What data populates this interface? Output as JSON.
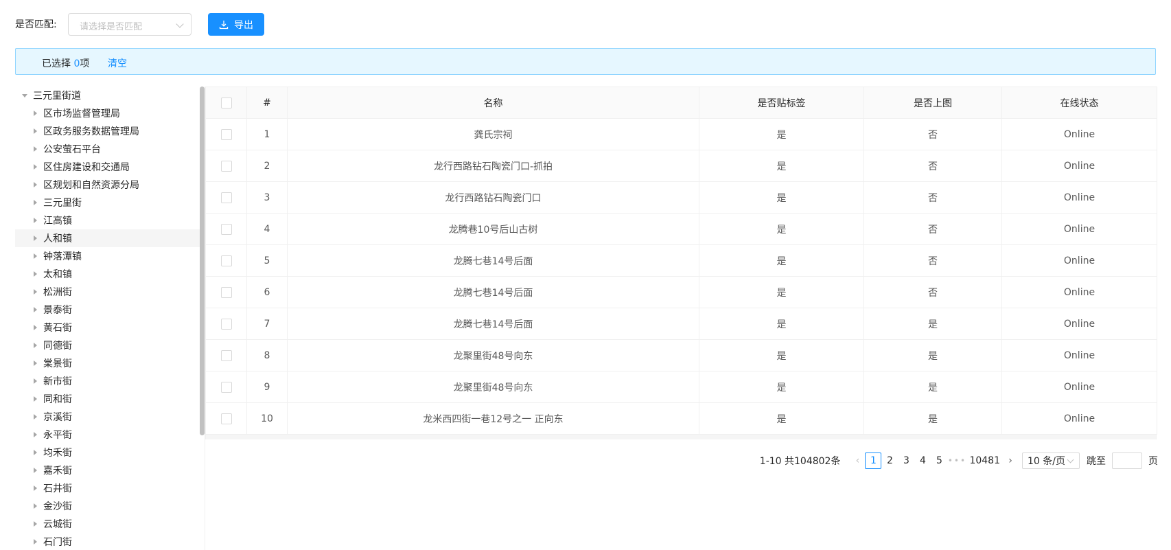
{
  "filter": {
    "label": "是否匹配:",
    "placeholder": "请选择是否匹配",
    "export_label": "导出"
  },
  "alert": {
    "selected_prefix": "已选择",
    "selected_count": "0",
    "selected_suffix": "项",
    "clear_label": "清空"
  },
  "tree": {
    "root": "三元里街道",
    "children": [
      "区市场监督管理局",
      "区政务服务数据管理局",
      "公安萤石平台",
      "区住房建设和交通局",
      "区规划和自然资源分局",
      "三元里街",
      "江高镇",
      "人和镇",
      "钟落潭镇",
      "太和镇",
      "松洲街",
      "景泰街",
      "黄石街",
      "同德街",
      "棠景街",
      "新市街",
      "同和街",
      "京溪街",
      "永平街",
      "均禾街",
      "嘉禾街",
      "石井街",
      "金沙街",
      "云城街",
      "石门街"
    ],
    "active_index": 7
  },
  "table": {
    "columns": [
      "#",
      "名称",
      "是否贴标签",
      "是否上图",
      "在线状态"
    ],
    "rows": [
      {
        "index": "1",
        "name": "龚氏宗祠",
        "labeled": "是",
        "mapped": "否",
        "status": "Online"
      },
      {
        "index": "2",
        "name": "龙行西路钻石陶瓷门口-抓拍",
        "labeled": "是",
        "mapped": "否",
        "status": "Online"
      },
      {
        "index": "3",
        "name": "龙行西路钻石陶瓷门口",
        "labeled": "是",
        "mapped": "否",
        "status": "Online"
      },
      {
        "index": "4",
        "name": "龙腾巷10号后山古树",
        "labeled": "是",
        "mapped": "否",
        "status": "Online"
      },
      {
        "index": "5",
        "name": "龙腾七巷14号后面",
        "labeled": "是",
        "mapped": "否",
        "status": "Online"
      },
      {
        "index": "6",
        "name": "龙腾七巷14号后面",
        "labeled": "是",
        "mapped": "否",
        "status": "Online"
      },
      {
        "index": "7",
        "name": "龙腾七巷14号后面",
        "labeled": "是",
        "mapped": "是",
        "status": "Online"
      },
      {
        "index": "8",
        "name": "龙聚里街48号向东",
        "labeled": "是",
        "mapped": "是",
        "status": "Online"
      },
      {
        "index": "9",
        "name": "龙聚里街48号向东",
        "labeled": "是",
        "mapped": "是",
        "status": "Online"
      },
      {
        "index": "10",
        "name": "龙米西四街一巷12号之一 正向东",
        "labeled": "是",
        "mapped": "是",
        "status": "Online"
      }
    ]
  },
  "pagination": {
    "total_text": "1-10 共104802条",
    "pages": [
      "1",
      "2",
      "3",
      "4",
      "5"
    ],
    "current": "1",
    "ellipsis": "•••",
    "last_page": "10481",
    "page_size": "10 条/页",
    "jump_label": "跳至",
    "page_label": "页"
  }
}
